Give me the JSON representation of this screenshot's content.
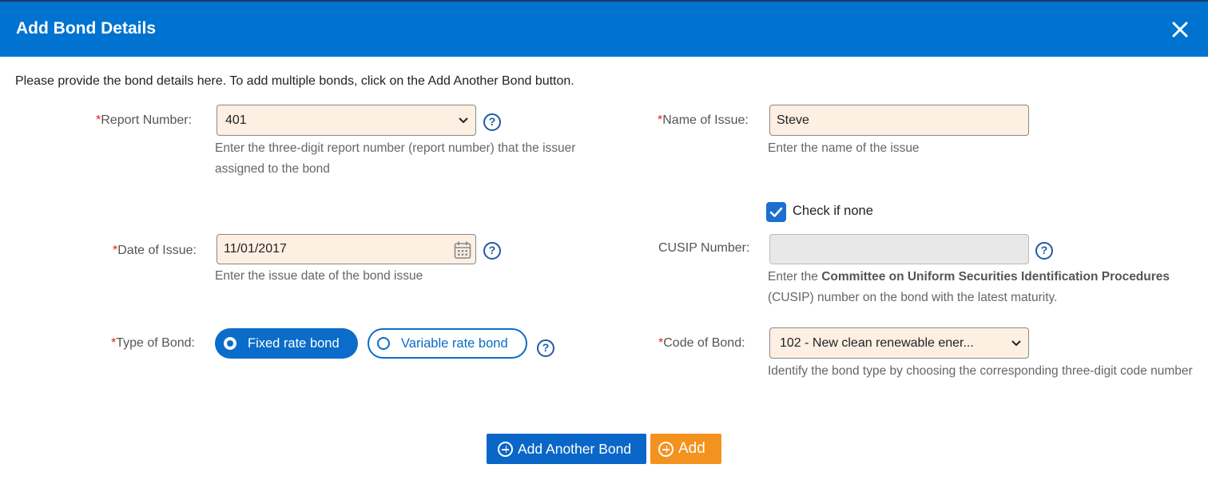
{
  "dialog": {
    "title": "Add Bond Details",
    "intro": "Please provide the bond details here. To add multiple bonds, click on the Add Another Bond button."
  },
  "required_marker": "*",
  "report_number": {
    "label": "Report Number:",
    "value": "401",
    "help": "Enter the three-digit report number (report number) that the issuer assigned to the bond"
  },
  "name_of_issue": {
    "label": "Name of Issue:",
    "value": "Steve",
    "help": "Enter the name of the issue"
  },
  "check_if_none": {
    "label": "Check if none",
    "checked": true
  },
  "date_of_issue": {
    "label": "Date of Issue:",
    "value": "11/01/2017",
    "help": "Enter the issue date of the bond issue"
  },
  "cusip": {
    "label": "CUSIP Number:",
    "value": "",
    "help_prefix": "Enter the ",
    "help_bold": "Committee on Uniform Securities Identification Procedures",
    "help_suffix": " (CUSIP) number on the bond with the latest maturity."
  },
  "type_of_bond": {
    "label": "Type of Bond:",
    "options": [
      "Fixed rate bond",
      "Variable rate bond"
    ],
    "selected": "Fixed rate bond"
  },
  "code_of_bond": {
    "label": "Code of Bond:",
    "value": "102 - New clean renewable ener...",
    "help": "Identify the bond type by choosing the corresponding three-digit code number"
  },
  "help_icon_glyph": "?",
  "buttons": {
    "add_another": "Add Another Bond",
    "add": "Add"
  },
  "icons": {
    "close": "close-icon",
    "help": "question-circle-icon",
    "calendar": "calendar-icon",
    "chevron": "chevron-down-icon",
    "plus": "plus-circle-icon",
    "check": "check-icon"
  },
  "colors": {
    "header": "#0073d1",
    "field_bg": "#fdf0e3",
    "primary_button": "#0a66c7",
    "add_button": "#f4921f",
    "required": "#e02020"
  }
}
